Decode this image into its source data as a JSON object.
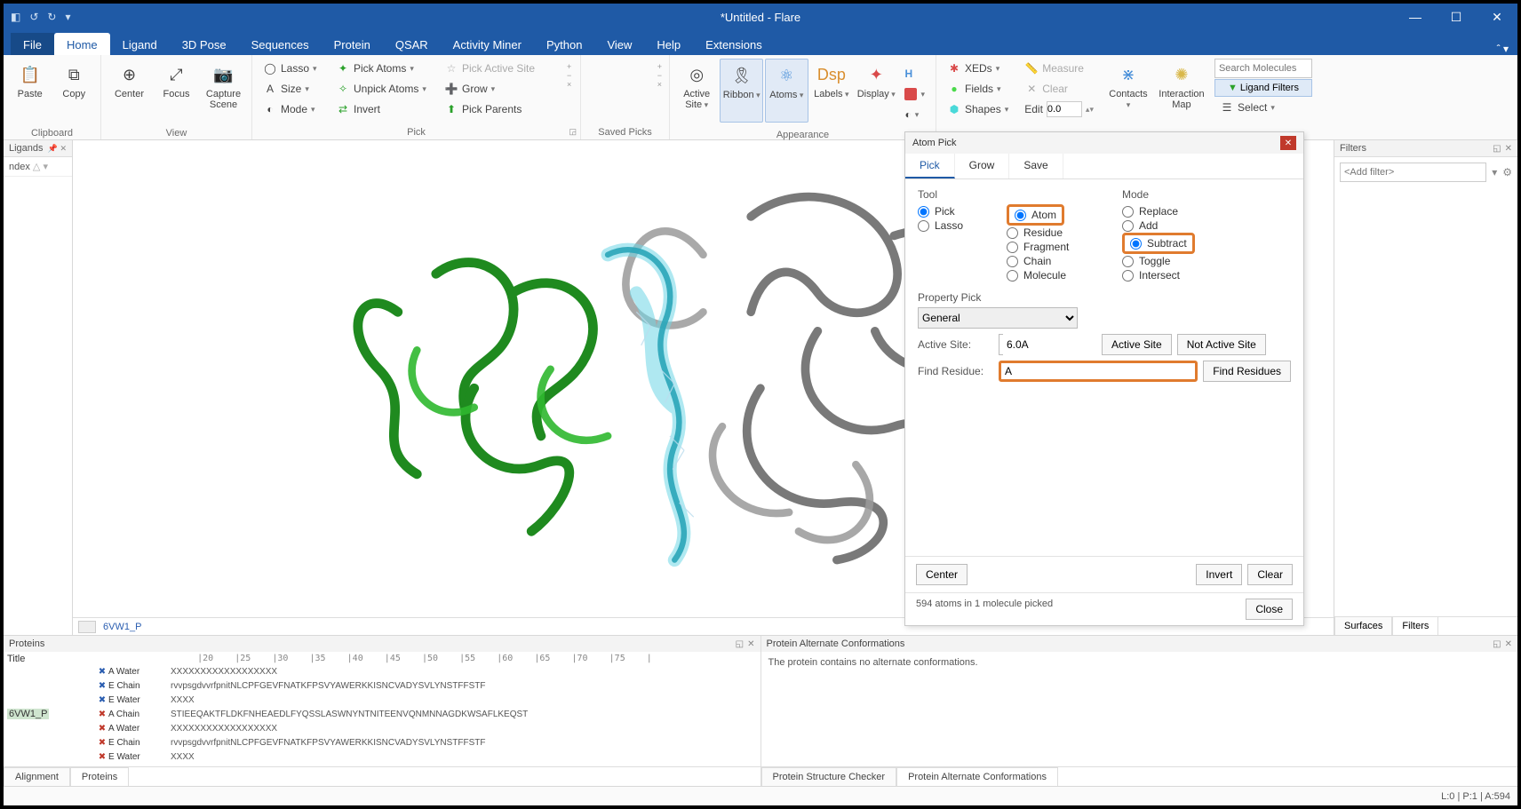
{
  "titlebar": {
    "title": "*Untitled - Flare"
  },
  "menubar": {
    "file": "File",
    "tabs": [
      "Home",
      "Ligand",
      "3D Pose",
      "Sequences",
      "Protein",
      "QSAR",
      "Activity Miner",
      "Python",
      "View",
      "Help",
      "Extensions"
    ],
    "active": "Home"
  },
  "ribbon": {
    "clipboard": {
      "label": "Clipboard",
      "paste": "Paste",
      "copy": "Copy"
    },
    "view": {
      "label": "View",
      "center": "Center",
      "focus": "Focus",
      "capture": "Capture\nScene"
    },
    "pick": {
      "label": "Pick",
      "lasso": "Lasso",
      "size": "Size",
      "mode": "Mode",
      "pick_atoms": "Pick Atoms",
      "unpick_atoms": "Unpick Atoms",
      "invert": "Invert",
      "pick_active_site": "Pick Active Site",
      "grow": "Grow",
      "pick_parents": "Pick Parents"
    },
    "saved_picks": {
      "label": "Saved Picks"
    },
    "appearance": {
      "label": "Appearance",
      "active_site": "Active\nSite",
      "ribbon": "Ribbon",
      "atoms": "Atoms",
      "labels": "Labels",
      "display": "Display"
    },
    "show": {
      "xeds": "XEDs",
      "fields": "Fields",
      "shapes": "Shapes",
      "measure": "Measure",
      "clear": "Clear",
      "edit": "Edit",
      "edit_val": "0.0",
      "contacts": "Contacts",
      "interaction_map": "Interaction\nMap"
    },
    "search": {
      "placeholder": "Search Molecules",
      "ligand_filters": "Ligand Filters",
      "select": "Select"
    }
  },
  "ligands_panel": {
    "title": "Ligands",
    "col": "ndex"
  },
  "viewport": {
    "footer_label": "6VW1_P"
  },
  "atom_pick": {
    "title": "Atom Pick",
    "tabs": [
      "Pick",
      "Grow",
      "Save"
    ],
    "active_tab": "Pick",
    "tool": {
      "label": "Tool",
      "options": [
        "Pick",
        "Lasso"
      ],
      "selected": "Pick"
    },
    "target": {
      "options": [
        "Atom",
        "Residue",
        "Fragment",
        "Chain",
        "Molecule"
      ],
      "selected": "Atom"
    },
    "mode": {
      "label": "Mode",
      "options": [
        "Replace",
        "Add",
        "Subtract",
        "Toggle",
        "Intersect"
      ],
      "selected": "Subtract"
    },
    "property_pick": {
      "label": "Property Pick",
      "value": "General"
    },
    "active_site": {
      "label": "Active Site:",
      "value": "6.0A",
      "btn1": "Active Site",
      "btn2": "Not Active Site"
    },
    "find_residue": {
      "label": "Find Residue:",
      "value": "A",
      "btn": "Find Residues"
    },
    "footer": {
      "center": "Center",
      "invert": "Invert",
      "clear": "Clear"
    },
    "status": "594 atoms in 1 molecule picked",
    "close": "Close"
  },
  "filters_panel": {
    "title": "Filters",
    "placeholder": "<Add filter>",
    "tabs": [
      "Surfaces",
      "Filters"
    ],
    "active": "Filters"
  },
  "proteins_panel": {
    "title": "Proteins",
    "header_title": "Title",
    "ruler": "    |20    |25    |30    |35    |40    |45    |50    |55    |60    |65    |70    |75    |",
    "protein_name": "6VW1_P",
    "chains": [
      {
        "ico": "blue-x",
        "label": "A Water",
        "seq": "XXXXXXXXXXXXXXXXXX"
      },
      {
        "ico": "blue-x",
        "label": "E Chain",
        "seq": "rvvpsgdvvrfpnitNLCPFGEVFNATKFPSVYAWERKKISNCVADYSVLYNSTFFSTF"
      },
      {
        "ico": "blue-x",
        "label": "E Water",
        "seq": "XXXX"
      },
      {
        "ico": "red-x",
        "label": "A Chain",
        "seq": "STIEEQAKTFLDKFNHEAEDLFYQSSLASWNYNTNITEENVQNMNNAGDKWSAFLKEQST"
      },
      {
        "ico": "red-x",
        "label": "A Water",
        "seq": "XXXXXXXXXXXXXXXXXX"
      },
      {
        "ico": "red-x",
        "label": "E Chain",
        "seq": "rvvpsgdvvrfpnitNLCPFGEVFNATKFPSVYAWERKKISNCVADYSVLYNSTFFSTF"
      },
      {
        "ico": "red-x",
        "label": "E Water",
        "seq": "XXXX"
      }
    ],
    "tabs": [
      "Alignment",
      "Proteins"
    ],
    "active_tab": "Proteins"
  },
  "alt_conf_panel": {
    "title": "Protein Alternate Conformations",
    "msg": "The protein contains no alternate conformations.",
    "tabs": [
      "Protein Structure Checker",
      "Protein Alternate Conformations"
    ],
    "active_tab": "Protein Alternate Conformations"
  },
  "statusbar": {
    "right": "L:0 | P:1 | A:594"
  }
}
